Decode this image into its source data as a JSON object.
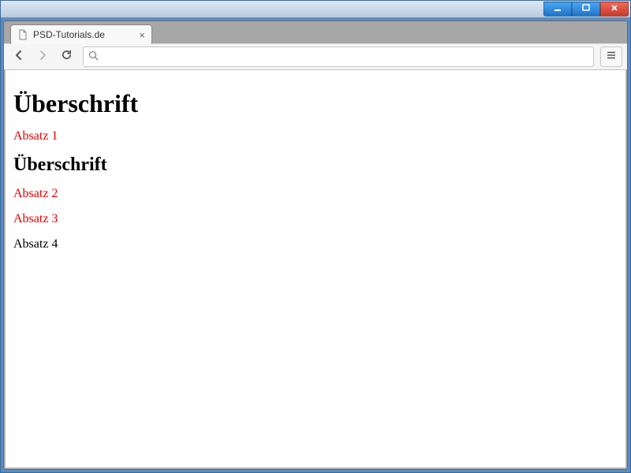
{
  "window": {
    "tab_title": "PSD-Tutorials.de",
    "address": ""
  },
  "page": {
    "h1": "Überschrift",
    "p1": "Absatz 1",
    "h2": "Überschrift",
    "p2": "Absatz 2",
    "p3": "Absatz 3",
    "p4": "Absatz 4"
  },
  "icons": {
    "search": "search-icon",
    "menu": "menu-icon",
    "back": "back-icon",
    "forward": "forward-icon",
    "reload": "reload-icon",
    "file": "file-icon",
    "close_tab": "close-icon",
    "minimize": "minimize-icon",
    "maximize": "maximize-icon",
    "close_window": "close-window-icon"
  }
}
